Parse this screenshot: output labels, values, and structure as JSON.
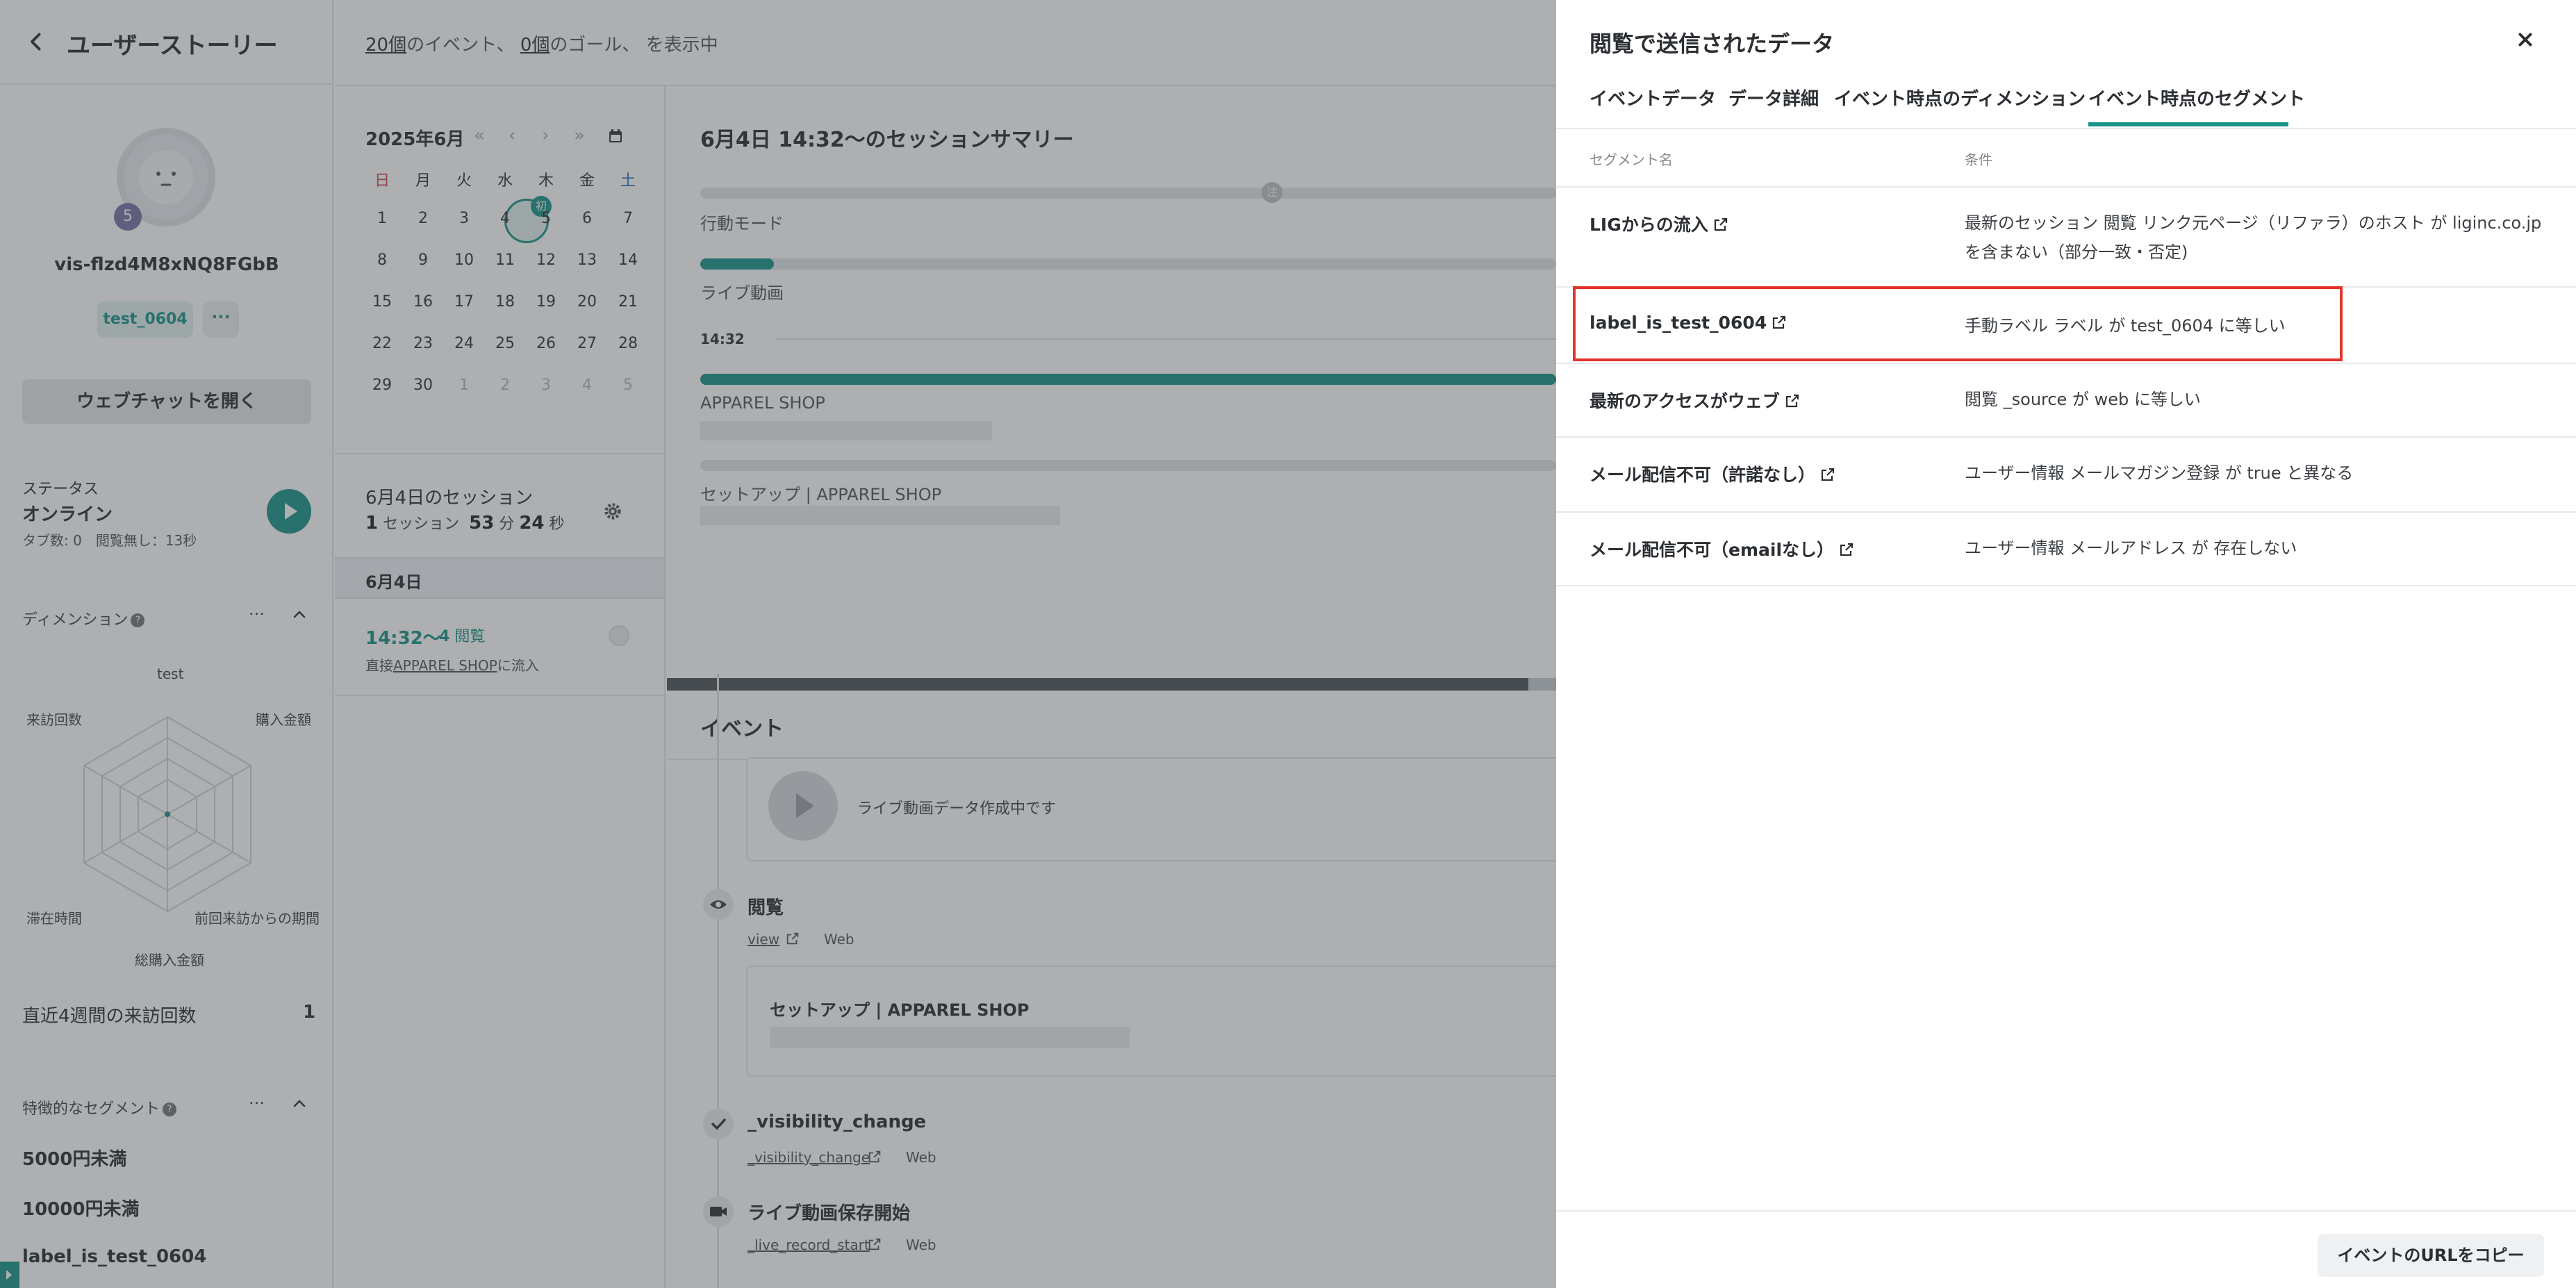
{
  "left": {
    "title": "ユーザーストーリー",
    "avatar_badge": "5",
    "visitor_id": "vis-flzd4M8xNQ8FGbB",
    "label_chip": "test_0604",
    "more_chip": "···",
    "chat_button": "ウェブチャットを開く",
    "status_label": "ステータス",
    "status_value": "オンライン",
    "status_sub": "タブ数: 0　閲覧無し：13秒",
    "dimensions_label": "ディメンション",
    "menu_dots": "···",
    "radar_labels": {
      "top": "test",
      "upper_left": "来訪回数",
      "upper_right": "購入金額",
      "lower_left": "滞在時間",
      "lower_right": "前回来訪からの期間",
      "bottom": "総購入金額"
    },
    "visits_label": "直近4週間の来訪回数",
    "visits_value": "1",
    "segments_label": "特徴的なセグメント",
    "segments": [
      "5000円未満",
      "10000円未満",
      "label_is_test_0604"
    ]
  },
  "mid": {
    "summary_events_count": "20個",
    "summary_events_text": "のイベント、",
    "summary_goals_count": "0個",
    "summary_goals_text": "のゴール、",
    "summary_tail": "を表示中",
    "calendar": {
      "month": "2025年6月",
      "nav": [
        "«",
        "‹",
        "›",
        "»"
      ],
      "weekdays": [
        "日",
        "月",
        "火",
        "水",
        "木",
        "金",
        "土"
      ],
      "weeks": [
        [
          "1",
          "2",
          "3",
          "4",
          "5",
          "6",
          "7"
        ],
        [
          "8",
          "9",
          "10",
          "11",
          "12",
          "13",
          "14"
        ],
        [
          "15",
          "16",
          "17",
          "18",
          "19",
          "20",
          "21"
        ],
        [
          "22",
          "23",
          "24",
          "25",
          "26",
          "27",
          "28"
        ],
        [
          "29",
          "30",
          "1",
          "2",
          "3",
          "4",
          "5"
        ]
      ],
      "first_badge": "初"
    },
    "sessions_title": "6月4日のセッション",
    "sessions_count": "1",
    "sessions_unit": "セッション",
    "sessions_min": "53",
    "sessions_min_unit": "分",
    "sessions_sec": "24",
    "sessions_sec_unit": "秒",
    "date_bar": "6月4日",
    "session_time": "14:32〜",
    "session_views_count": "4",
    "session_views_unit": "閲覧",
    "session_src_prefix": "直接",
    "session_src_link": "APPAREL SHOP",
    "session_src_suffix": "に流入",
    "summary_title": "6月4日 14:32〜のセッションサマリー",
    "marker_label": "注",
    "mode_label": "行動モード",
    "live_label": "ライブ動画",
    "time_label": "14:32",
    "page1": "APPAREL SHOP",
    "page2": "セットアップ | APPAREL SHOP",
    "events_title": "イベント",
    "live_creating": "ライブ動画データ作成中です",
    "ev_view_title": "閲覧",
    "ev_view_link": "view",
    "ev_web": "Web",
    "ev_view_card_title": "セットアップ | APPAREL SHOP",
    "ev_vis_title": "_visibility_change",
    "ev_vis_link": "_visibility_change",
    "ev_rec_title": "ライブ動画保存開始",
    "ev_rec_link": "_live_record_start"
  },
  "panel": {
    "title": "閲覧で送信されたデータ",
    "tabs": [
      "イベントデータ",
      "データ詳細",
      "イベント時点のディメンション",
      "イベント時点のセグメント"
    ],
    "active_tab": "イベント時点のセグメント",
    "col_name": "セグメント名",
    "col_cond": "条件",
    "rows": [
      {
        "name": "LIGからの流入",
        "cond": "最新のセッション 閲覧 リンク元ページ（リファラ）のホスト が liginc.co.jp を含まない（部分一致・否定)"
      },
      {
        "name": "label_is_test_0604",
        "cond": "手動ラベル ラベル が test_0604 に等しい"
      },
      {
        "name": "最新のアクセスがウェブ",
        "cond": "閲覧 _source が web に等しい"
      },
      {
        "name": "メール配信不可（許諾なし）",
        "cond": "ユーザー情報 メールマガジン登録 が true と異なる"
      },
      {
        "name": "メール配信不可（emailなし）",
        "cond": "ユーザー情報 メールアドレス が 存在しない"
      }
    ],
    "copy_button": "イベントのURLをコピー"
  },
  "colors": {
    "accent": "#1b9488",
    "highlight": "#e3352a",
    "overlay": "rgba(60,64,68,0.42)"
  }
}
